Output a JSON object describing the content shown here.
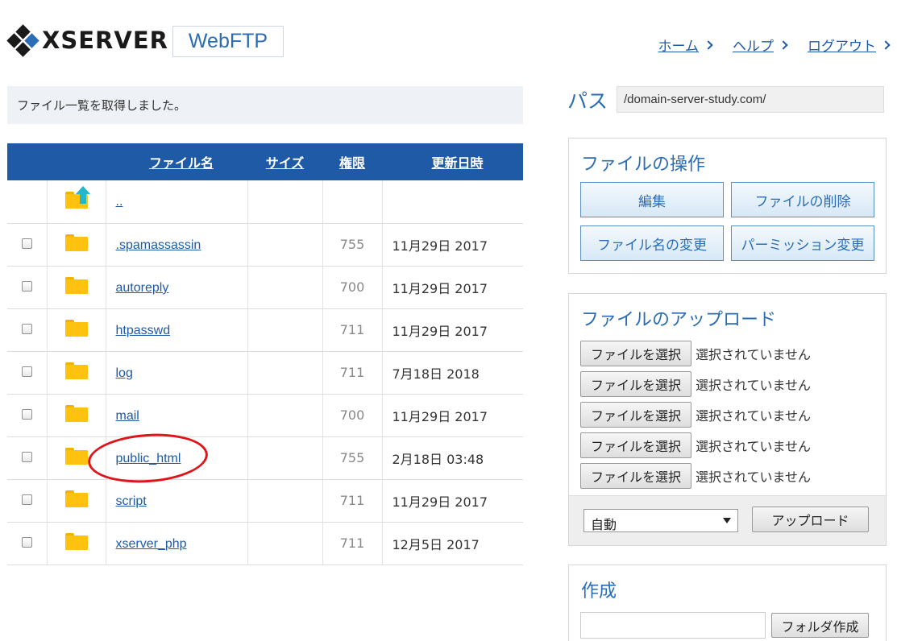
{
  "header": {
    "logo_text": "XSERVER",
    "product_badge": "WebFTP",
    "nav": [
      {
        "label": "ホーム"
      },
      {
        "label": "ヘルプ"
      },
      {
        "label": "ログアウト"
      }
    ]
  },
  "message": "ファイル一覧を取得しました。",
  "table": {
    "headers": {
      "name": "ファイル名",
      "size": "サイズ",
      "perm": "権限",
      "date": "更新日時"
    },
    "parent_link": "..",
    "rows": [
      {
        "name": ".spamassassin",
        "size": "",
        "perm": "755",
        "date": "11月29日 2017"
      },
      {
        "name": "autoreply",
        "size": "",
        "perm": "700",
        "date": "11月29日 2017"
      },
      {
        "name": "htpasswd",
        "size": "",
        "perm": "711",
        "date": "11月29日 2017"
      },
      {
        "name": "log",
        "size": "",
        "perm": "711",
        "date": "7月18日 2018"
      },
      {
        "name": "mail",
        "size": "",
        "perm": "700",
        "date": "11月29日 2017"
      },
      {
        "name": "public_html",
        "size": "",
        "perm": "755",
        "date": "2月18日 03:48",
        "highlighted": true
      },
      {
        "name": "script",
        "size": "",
        "perm": "711",
        "date": "11月29日 2017"
      },
      {
        "name": "xserver_php",
        "size": "",
        "perm": "711",
        "date": "12月5日 2017"
      }
    ]
  },
  "path": {
    "label": "パス",
    "value": "/domain-server-study.com/"
  },
  "file_ops": {
    "title": "ファイルの操作",
    "buttons": [
      "編集",
      "ファイルの削除",
      "ファイル名の変更",
      "パーミッション変更"
    ]
  },
  "upload": {
    "title": "ファイルのアップロード",
    "choose_label": "ファイルを選択",
    "no_file_label": "選択されていません",
    "slots": 5,
    "mode_value": "自動",
    "upload_button": "アップロード"
  },
  "create": {
    "title": "作成",
    "folder_button": "フォルダ作成"
  },
  "colors": {
    "brand_blue": "#1f5aa6",
    "folder_yellow": "#ffc20e",
    "highlight_red": "#e0141b"
  }
}
